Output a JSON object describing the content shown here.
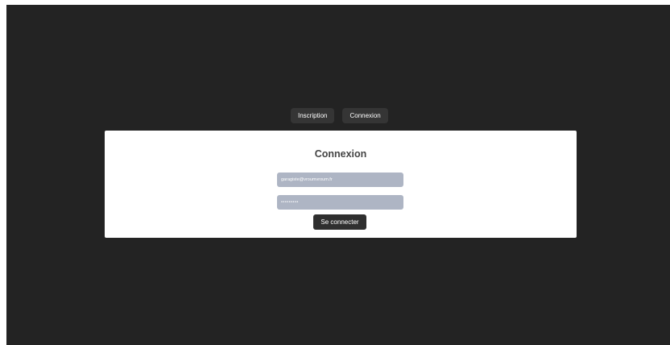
{
  "tabs": {
    "signup_label": "Inscription",
    "login_label": "Connexion"
  },
  "login_form": {
    "title": "Connexion",
    "email_value": "garagiste@vroumvroum.fr",
    "password_value": "password1",
    "submit_label": "Se connecter"
  },
  "colors": {
    "page_background": "#232323",
    "card_background": "#ffffff",
    "input_background": "#aeb5c4",
    "button_background": "#2f2f2f",
    "tab_background": "#353535"
  }
}
